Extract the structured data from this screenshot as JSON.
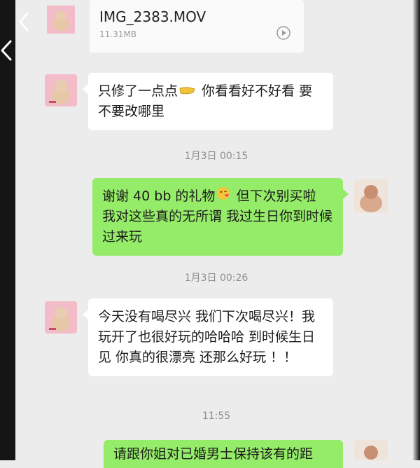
{
  "file_message": {
    "name": "IMG_2383.MOV",
    "size": "11.31MB"
  },
  "messages": [
    {
      "side": "in",
      "text_a": "只修了一点点",
      "emoji": "hand-pointing-icon",
      "text_b": " 你看看好不好看 要不要改哪里"
    },
    {
      "side": "out",
      "text_a": "谢谢 40 bb 的礼物",
      "emoji": "face-blowing-kiss-icon",
      "text_b": " 但下次别买啦 我对这些真的无所谓 我过生日你到时候过来玩"
    },
    {
      "side": "in",
      "text": "今天没有喝尽兴 我们下次喝尽兴！我玩开了也很好玩的哈哈哈 到时候生日见 你真的很漂亮 还那么好玩 ！！"
    },
    {
      "side": "out",
      "text": "请跟你姐对已婚男士保持该有的距"
    }
  ],
  "timestamps": [
    "1月3日 00:15",
    "1月3日 00:26",
    "11:55"
  ],
  "colors": {
    "background": "#ececec",
    "incoming_bubble": "#ffffff",
    "outgoing_bubble": "#95ec69",
    "timestamp_text": "#8e8e8e"
  }
}
